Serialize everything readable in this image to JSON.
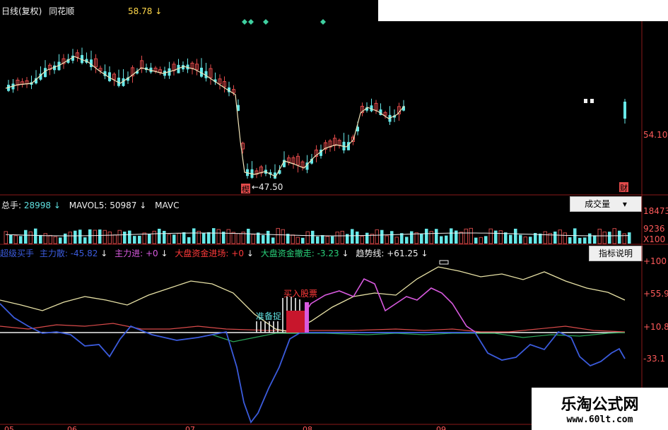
{
  "colors": {
    "bg": "#000000",
    "price_line": "#f1e4b8",
    "candle_up": "#e24a4a",
    "candle_down": "#67e8e8",
    "volume_down": "#67e8e8",
    "volume_up": "#c54545",
    "cyan_text": "#5fe0e0",
    "yellow_text": "#ffd84a",
    "white_text": "#f0f0f0",
    "red_text": "#ff3a3a",
    "green_text": "#29d17a",
    "magenta": "#d85adf",
    "blue_line": "#3b5bdc",
    "green_line": "#2ca85a",
    "red_line": "#d84a4a",
    "trend_line": "#e8e2a6",
    "axis_red": "#ff5a5a"
  },
  "price_header": {
    "title": "日线(复权)",
    "stock_name": "同花顺",
    "price": "58.78",
    "arrow": "↓"
  },
  "price_axis": {
    "label": "54.10"
  },
  "price_markers": {
    "low_label": "←47.50",
    "low_badge": "楔",
    "right_badge": "财"
  },
  "volume_header": {
    "total_label": "总手:",
    "total_value": "28998",
    "total_arrow": "↓",
    "mavol5_label": "MAVOL5:",
    "mavol5_value": "50987",
    "mavol5_arrow": "↓",
    "mavol_more": "MAVC"
  },
  "volume_button": {
    "label": "成交量",
    "caret": "▾"
  },
  "volume_axis": {
    "top": "18473",
    "mid": "9236",
    "unit": "X100"
  },
  "indicator_header": {
    "items": [
      {
        "label": "超级买手",
        "value": "",
        "arrow": ""
      },
      {
        "label": "主力散:",
        "value": "-45.82",
        "arrow": "↓"
      },
      {
        "label": "主力进:",
        "value": "+0",
        "arrow": "↓"
      },
      {
        "label": "大盘资金进场:",
        "value": "+0",
        "arrow": "↓"
      },
      {
        "label": "大盘资金撤走:",
        "value": "-3.23",
        "arrow": "↓"
      },
      {
        "label": "趋势线:",
        "value": "+61.25",
        "arrow": "↓"
      }
    ]
  },
  "indicator_button": {
    "label": "指标说明"
  },
  "indicator_axis": {
    "t1": "+100",
    "t2": "+55.9",
    "t3": "+10.8",
    "t4": "-33.1"
  },
  "indicator_annotations": {
    "prepare": "准备捉",
    "buy": "买入股票"
  },
  "x_axis": {
    "labels": [
      "05",
      "06",
      "07",
      "08",
      "09"
    ]
  },
  "watermark": {
    "name": "乐淘公式网",
    "url": "www.60lt.com"
  }
}
